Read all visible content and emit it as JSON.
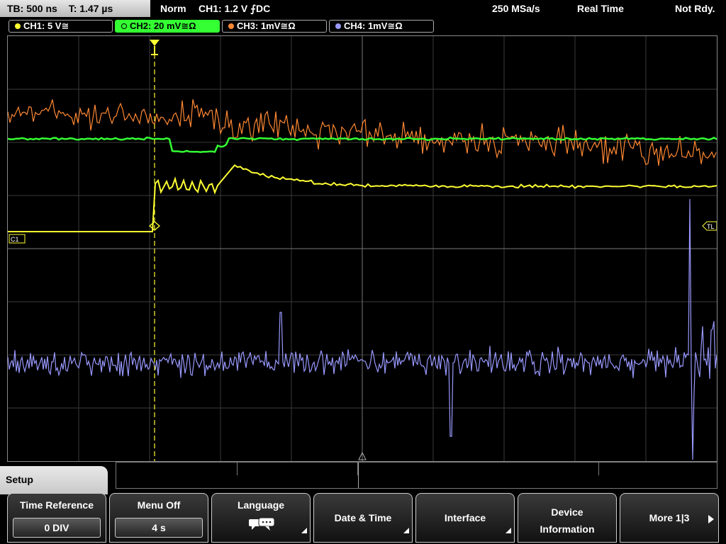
{
  "status": {
    "timebase": "TB: 500 ns",
    "trigger_time": "T: 1.47 µs",
    "trigger_mode": "Norm",
    "trigger_info": "CH1: 1.2 V ⨍DC",
    "sample_rate": "250 MSa/s",
    "acq_mode": "Real Time",
    "state": "Not Rdy."
  },
  "channels": [
    {
      "label": "CH1: 5 V≅",
      "color": "#ffff33"
    },
    {
      "label": "CH2: 20 mV≅Ω",
      "color": "#33ff33"
    },
    {
      "label": "CH3: 1mV≅Ω",
      "color": "#ff8833"
    },
    {
      "label": "CH4: 1mV≅Ω",
      "color": "#9999ff"
    }
  ],
  "markers": {
    "trigger_level": "TL",
    "ch1_ref": "C1"
  },
  "menu": {
    "title": "Setup",
    "time_reference": {
      "label": "Time Reference",
      "value": "0 DIV"
    },
    "menu_off": {
      "label": "Menu Off",
      "value": "4 s"
    },
    "language": {
      "label": "Language",
      "icon": "speech-bubbles-icon"
    },
    "date_time": {
      "label": "Date & Time"
    },
    "interface": {
      "label": "Interface"
    },
    "device_info": {
      "line1": "Device",
      "line2": "Information"
    },
    "more": {
      "label": "More 1|3"
    }
  }
}
